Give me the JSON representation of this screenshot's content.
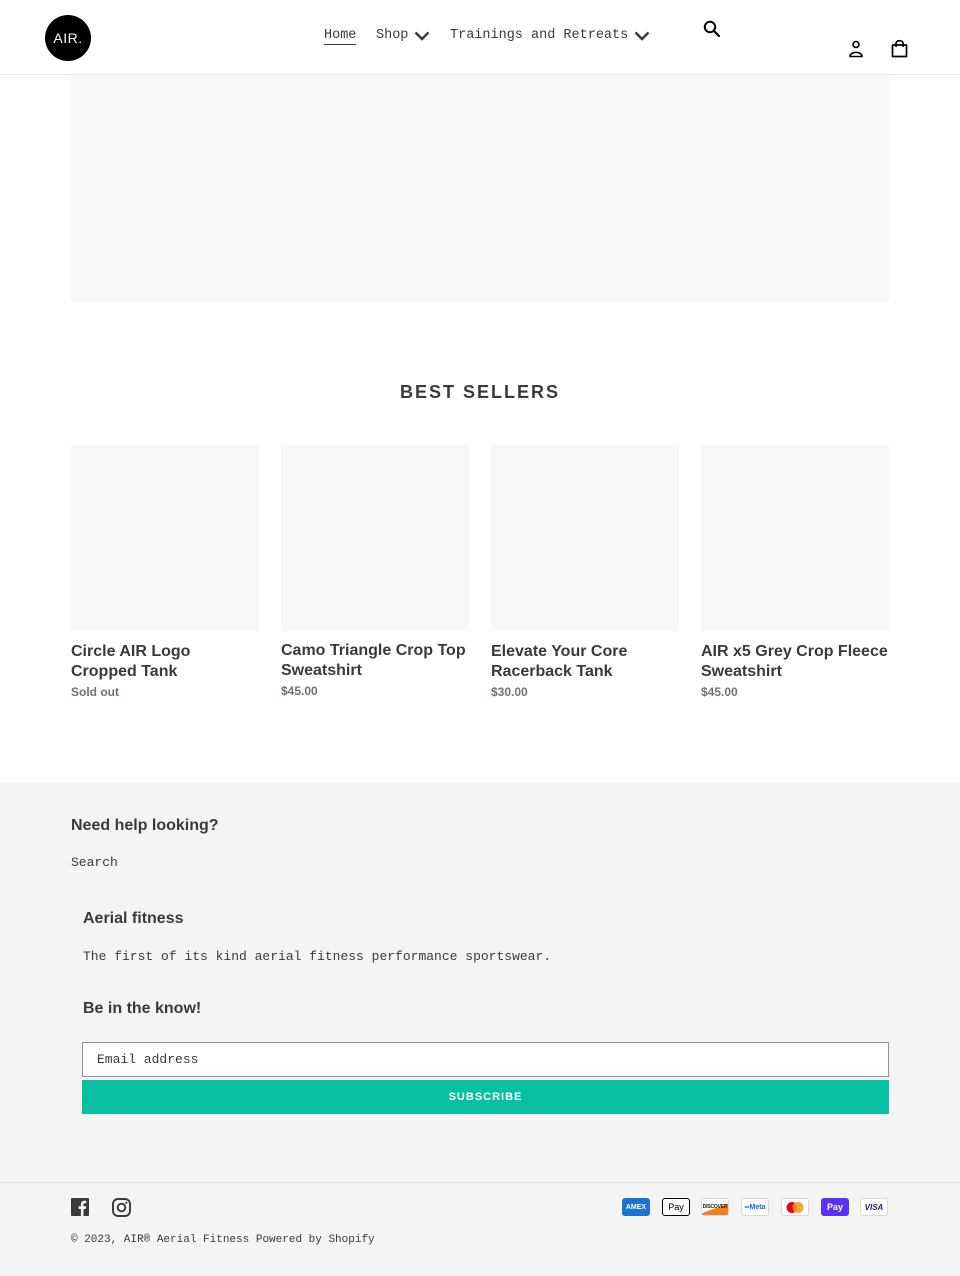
{
  "header": {
    "logo_text": "AIR.",
    "nav": [
      {
        "label": "Home",
        "active": true,
        "has_dropdown": false
      },
      {
        "label": "Shop",
        "active": false,
        "has_dropdown": true
      },
      {
        "label": "Trainings and Retreats",
        "active": false,
        "has_dropdown": true
      }
    ],
    "icons": {
      "search": "search-icon",
      "account": "account-icon",
      "cart": "cart-icon"
    }
  },
  "best_sellers": {
    "title": "BEST SELLERS",
    "products": [
      {
        "title": "Circle AIR Logo Cropped Tank",
        "price": "Sold out"
      },
      {
        "title": "Camo Triangle Crop Top Sweatshirt",
        "price": "$45.00"
      },
      {
        "title": "Elevate Your Core Racerback Tank",
        "price": "$30.00"
      },
      {
        "title": "AIR x5 Grey Crop Fleece Sweatshirt",
        "price": "$45.00"
      }
    ]
  },
  "footer": {
    "help_heading": "Need help looking?",
    "help_link": "Search",
    "about_heading": "Aerial fitness",
    "about_text": "The first of its kind aerial fitness performance sportswear.",
    "newsletter_heading": "Be in the know!",
    "email_placeholder": "Email address",
    "subscribe_label": "SUBSCRIBE",
    "social": [
      "facebook-icon",
      "instagram-icon"
    ],
    "copyright": "© 2023, AIR® Aerial Fitness",
    "powered_by": "Powered by Shopify",
    "payment_methods": [
      {
        "name": "American Express",
        "label": "AMEX",
        "bg": "#1f72cd",
        "fg": "#ffffff"
      },
      {
        "name": "Apple Pay",
        "label": " Pay",
        "bg": "#ffffff",
        "fg": "#000000"
      },
      {
        "name": "Discover",
        "label": "DISCOVER",
        "bg": "#ffffff",
        "fg": "#231f20"
      },
      {
        "name": "Meta Pay",
        "label": "∞Meta",
        "bg": "#ffffff",
        "fg": "#0668e1"
      },
      {
        "name": "Mastercard",
        "label": "",
        "bg": "#ffffff",
        "fg": "#000000"
      },
      {
        "name": "Shop Pay",
        "label": "Pay",
        "bg": "#5a31f4",
        "fg": "#ffffff"
      },
      {
        "name": "Visa",
        "label": "VISA",
        "bg": "#ffffff",
        "fg": "#1a1f71"
      }
    ]
  },
  "colors": {
    "accent": "#08bfa1",
    "text": "#3a3a3a",
    "footer_bg": "#f4f4f4"
  }
}
